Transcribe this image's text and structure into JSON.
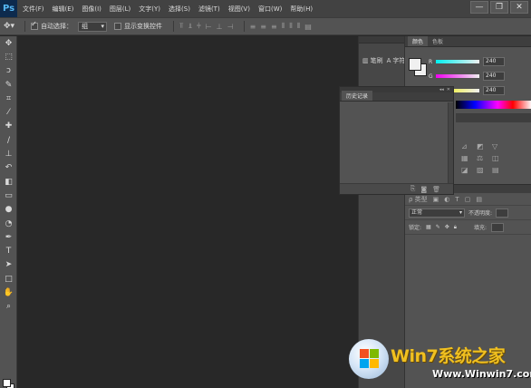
{
  "app": {
    "logo_text": "Ps"
  },
  "menu": [
    "文件(F)",
    "编辑(E)",
    "图像(I)",
    "图层(L)",
    "文字(Y)",
    "选择(S)",
    "滤镜(T)",
    "视图(V)",
    "窗口(W)",
    "帮助(H)"
  ],
  "window_controls": {
    "minimize": "—",
    "restore": "❐",
    "close": "✕"
  },
  "options": {
    "auto_select_label": "自动选择：",
    "auto_select_checked": true,
    "auto_select_value": "组",
    "show_transform_label": "显示变换控件",
    "show_transform_checked": false
  },
  "tools": [
    {
      "name": "move-tool",
      "glyph": "✥"
    },
    {
      "name": "marquee-tool",
      "glyph": "⬚"
    },
    {
      "name": "lasso-tool",
      "glyph": "ↄ"
    },
    {
      "name": "quick-select-tool",
      "glyph": "✎"
    },
    {
      "name": "crop-tool",
      "glyph": "⌗"
    },
    {
      "name": "eyedropper-tool",
      "glyph": "⁄"
    },
    {
      "name": "healing-brush-tool",
      "glyph": "✚"
    },
    {
      "name": "brush-tool",
      "glyph": "∕"
    },
    {
      "name": "clone-stamp-tool",
      "glyph": "⊥"
    },
    {
      "name": "history-brush-tool",
      "glyph": "↶"
    },
    {
      "name": "eraser-tool",
      "glyph": "◧"
    },
    {
      "name": "gradient-tool",
      "glyph": "▭"
    },
    {
      "name": "blur-tool",
      "glyph": "●"
    },
    {
      "name": "dodge-tool",
      "glyph": "◔"
    },
    {
      "name": "pen-tool",
      "glyph": "✒"
    },
    {
      "name": "type-tool",
      "glyph": "T"
    },
    {
      "name": "path-select-tool",
      "glyph": "➤"
    },
    {
      "name": "shape-tool",
      "glyph": "□"
    },
    {
      "name": "hand-tool",
      "glyph": "✋"
    },
    {
      "name": "zoom-tool",
      "glyph": "⌕"
    }
  ],
  "dock": {
    "brush_label": "笔刷",
    "char_label": "字符"
  },
  "color_panel": {
    "tabs": [
      "颜色",
      "色板"
    ],
    "active_tab": 0,
    "channels": [
      {
        "label": "R",
        "value": "240",
        "gradient": "linear-gradient(90deg, #00f0f0, #f0f0f0)"
      },
      {
        "label": "G",
        "value": "240",
        "gradient": "linear-gradient(90deg, #f000f0, #f0f0f0)"
      },
      {
        "label": "B",
        "value": "240",
        "gradient": "linear-gradient(90deg, #f0f000, #f0f0f0)"
      }
    ]
  },
  "history_panel": {
    "title": "历史记录",
    "collapse": "◂◂",
    "close": "✕"
  },
  "layers_panel": {
    "filter_label": "ρ 类型",
    "blend_mode": "正常",
    "opacity_label": "不透明度:",
    "lock_label": "锁定:",
    "fill_label": "填充:"
  },
  "watermark": {
    "title": "Win7系统之家",
    "url": "Www.Winwin7.com"
  }
}
